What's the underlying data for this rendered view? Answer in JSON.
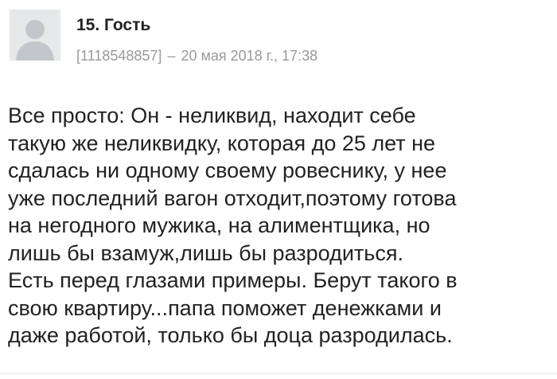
{
  "comment": {
    "author": "15. Гость",
    "user_id": "[1118548857]",
    "separator": "–",
    "date": "20 мая 2018 г., 17:38",
    "avatar_icon": "default-user-avatar-icon",
    "text_lines": [
      "Все просто: Он - неликвид, находит себе",
      "такую же неликвидку, которая до 25 лет не",
      "сдалась ни одному своему ровеснику, у нее",
      "уже последний вагон отходит,поэтому готова",
      "на негодного мужика, на алиментщика, но",
      "лишь бы взамуж,лишь бы разродиться.",
      "Есть перед глазами примеры. Берут такого в",
      "свою квартиру...папа поможет денежками и",
      "даже работой, только бы доца разродилась."
    ]
  }
}
